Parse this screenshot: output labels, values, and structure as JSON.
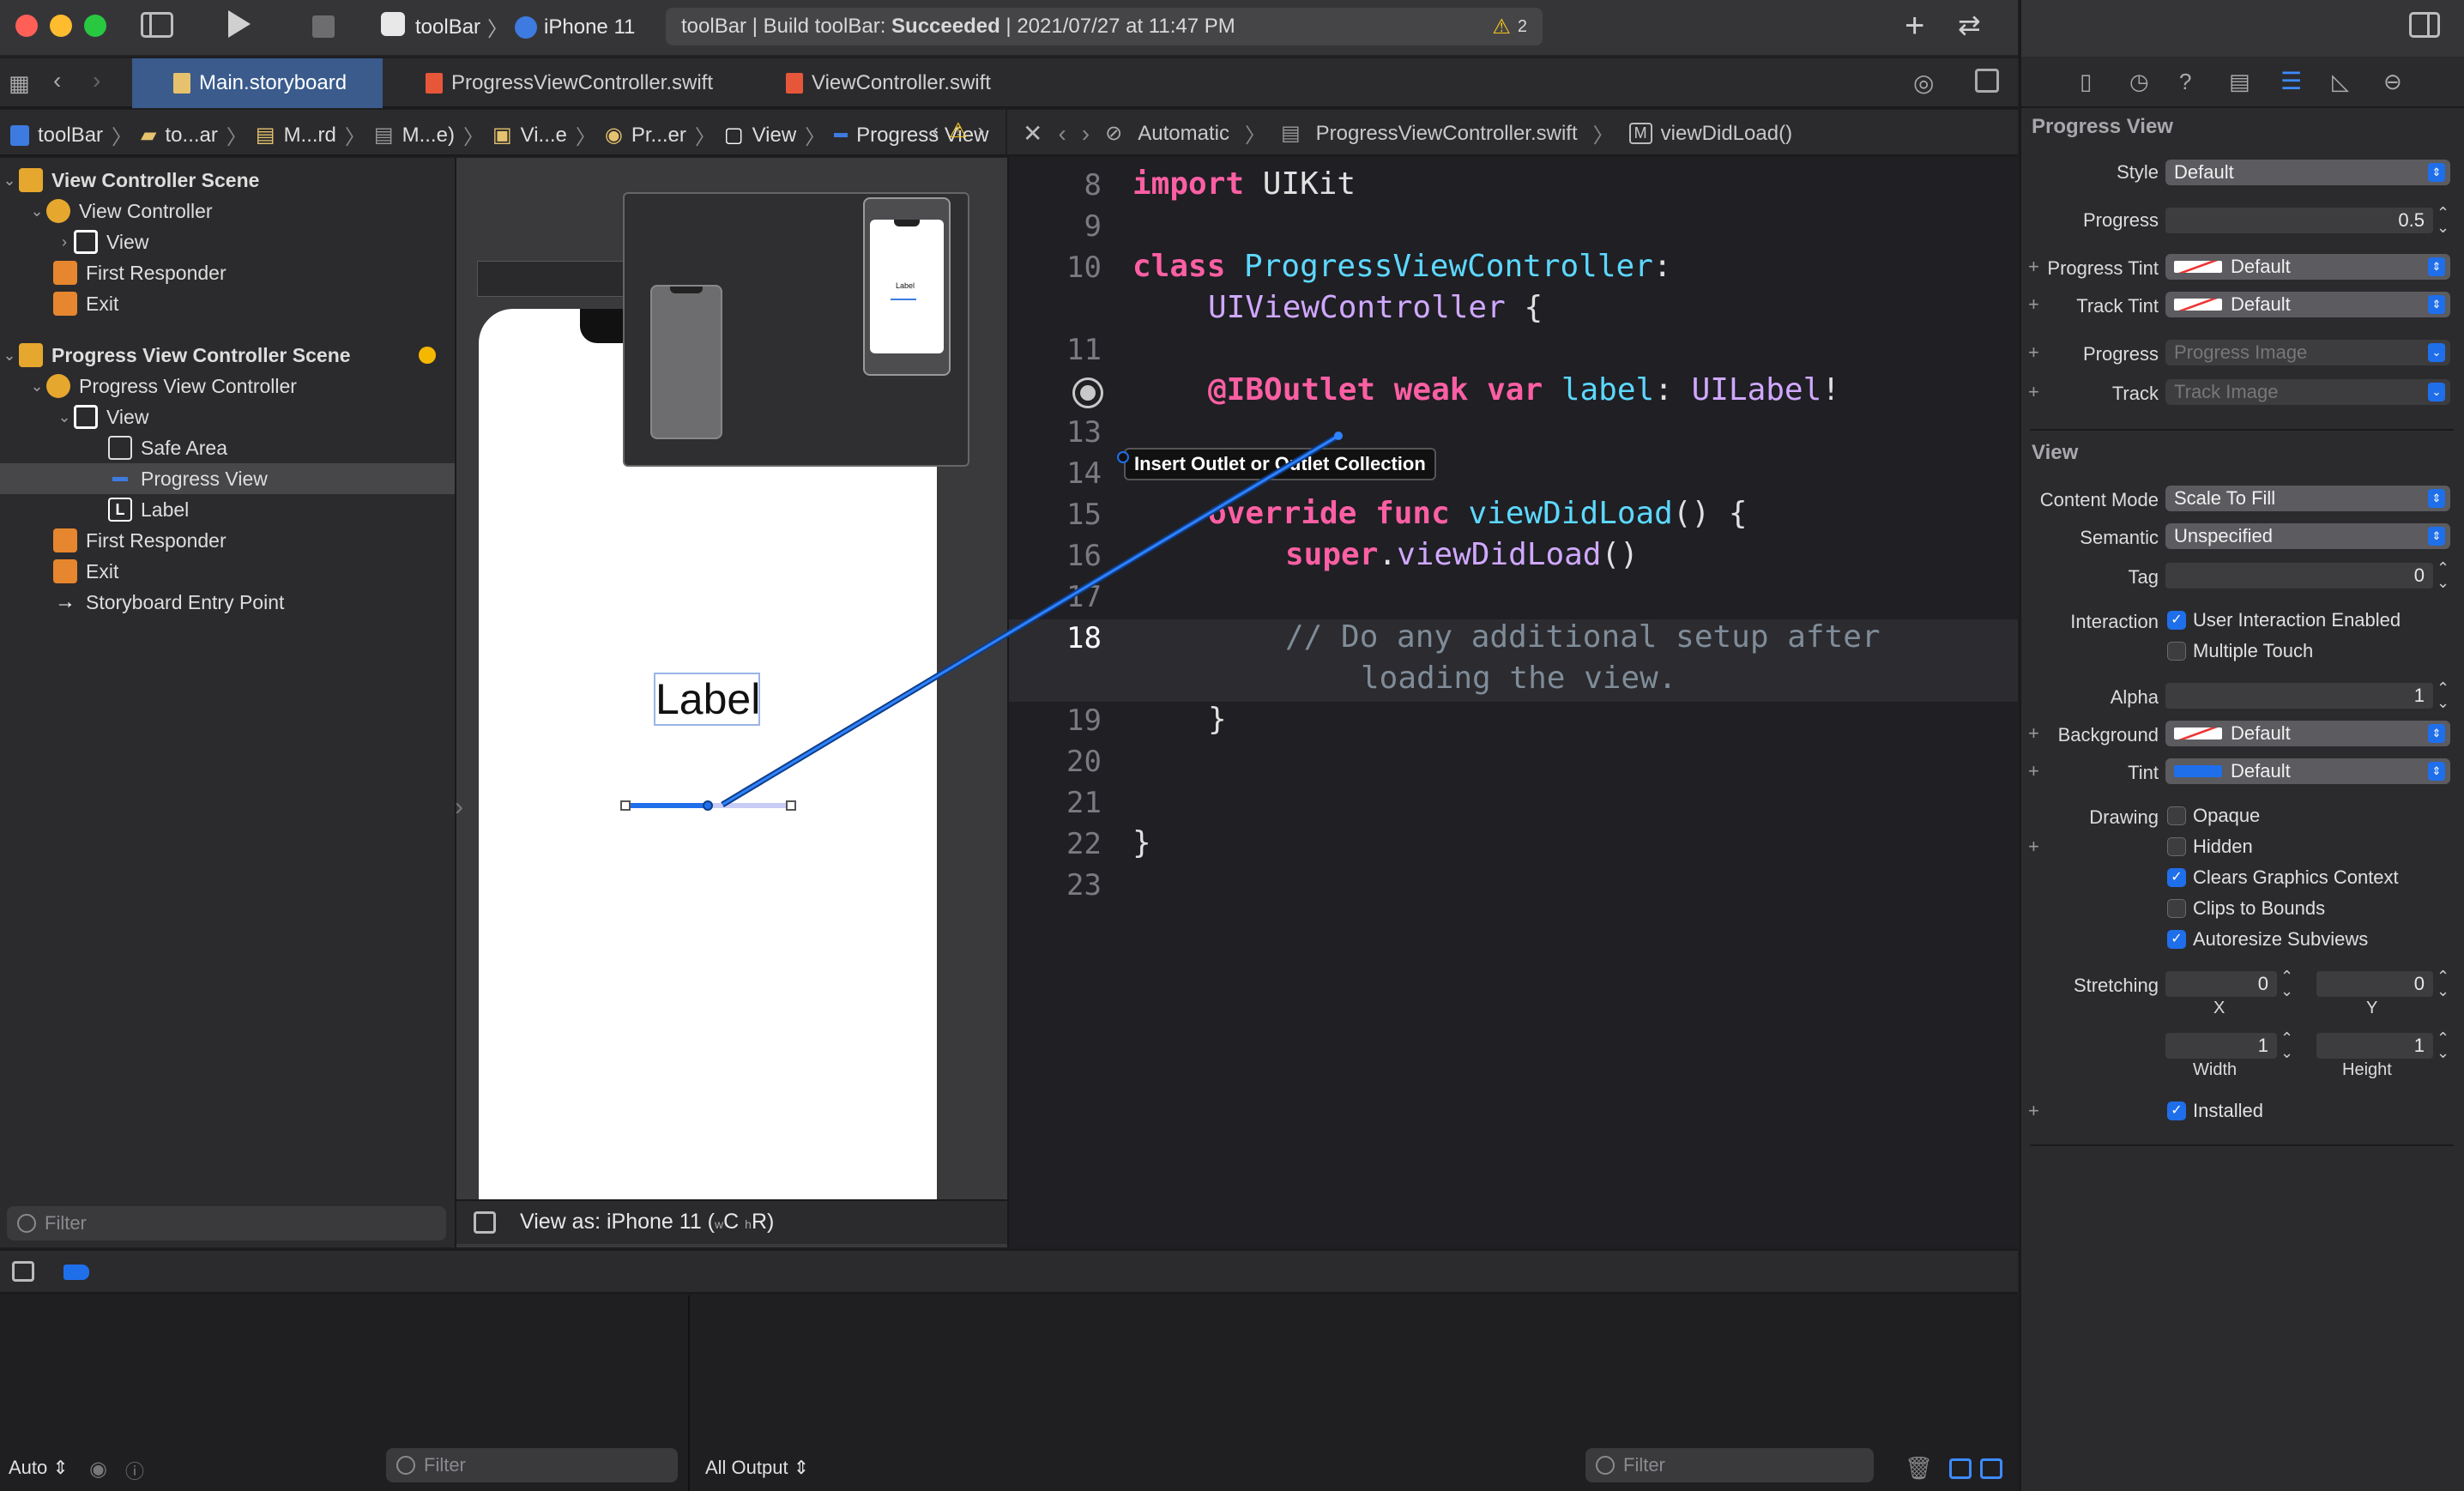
{
  "toolbar": {
    "scheme": "toolBar",
    "device": "iPhone 11",
    "activity_prefix": "toolBar | Build toolBar: ",
    "activity_status": "Succeeded",
    "activity_time": " | 2021/07/27 at 11:47 PM",
    "warning_count": "2"
  },
  "tabs": [
    {
      "label": "Main.storyboard",
      "active": true
    },
    {
      "label": "ProgressViewController.swift",
      "active": false
    },
    {
      "label": "ViewController.swift",
      "active": false
    }
  ],
  "jumpbar_left": {
    "items": [
      "toolBar",
      "to...ar",
      "M...rd",
      "M...e)",
      "Vi...e",
      "Pr...er",
      "View",
      "Progress View"
    ]
  },
  "jumpbar_right": {
    "mode": "Automatic",
    "file": "ProgressViewController.swift",
    "symbol_badge": "M",
    "symbol": "viewDidLoad()"
  },
  "outline": {
    "rows": [
      {
        "label": "View Controller Scene",
        "bold": true
      },
      {
        "label": "View Controller"
      },
      {
        "label": "View"
      },
      {
        "label": "First Responder"
      },
      {
        "label": "Exit"
      },
      {
        "label": "Progress View Controller Scene",
        "bold": true
      },
      {
        "label": "Progress View Controller"
      },
      {
        "label": "View"
      },
      {
        "label": "Safe Area"
      },
      {
        "label": "Progress View",
        "selected": true
      },
      {
        "label": "Label"
      },
      {
        "label": "First Responder"
      },
      {
        "label": "Exit"
      },
      {
        "label": "Storyboard Entry Point"
      }
    ],
    "filter_placeholder": "Filter"
  },
  "canvas": {
    "label_text": "Label",
    "preview_label_text": "Label",
    "view_as": "View as: iPhone 11 (",
    "size_class_w": "w",
    "size_class_w_val": "C",
    "size_class_h": "h",
    "size_class_h_val": "R)",
    "progress": 0.5
  },
  "editor": {
    "tooltip": "Insert Outlet or Outlet Collection",
    "line_numbers": [
      "8",
      "9",
      "10",
      "",
      "11",
      "",
      "13",
      "14",
      "15",
      "16",
      "17",
      "18",
      "",
      "19",
      "20",
      "21",
      "22",
      "23"
    ],
    "lines": {
      "l8_kw": "import",
      "l8_rest": " UIKit",
      "l10_kw": "class",
      "l10_type": " ProgressViewController",
      "l10_colon": ":",
      "l10b_type": "UIViewController",
      "l10b_rest": " {",
      "l12_attr": "@IBOutlet",
      "l12_kw": " weak var",
      "l12_name": " label",
      "l12_colon": ": ",
      "l12_type": "UILabel",
      "l12_bang": "!",
      "l15_kw": "override func",
      "l15_name": " viewDidLoad",
      "l15_rest": "() {",
      "l16_kw": "super",
      "l16_dot": ".",
      "l16_name": "viewDidLoad",
      "l16_rest": "()",
      "l18_comment": "// Do any additional setup after",
      "l18b_comment": "loading the view.",
      "l19": "}",
      "l22": "}"
    }
  },
  "inspector": {
    "progress_section": "Progress View",
    "style_label": "Style",
    "style_value": "Default",
    "progress_label": "Progress",
    "progress_value": "0.5",
    "progress_tint_label": "Progress Tint",
    "progress_tint_value": "Default",
    "track_tint_label": "Track Tint",
    "track_tint_value": "Default",
    "progress_image_label": "Progress",
    "progress_image_placeholder": "Progress Image",
    "track_image_label": "Track",
    "track_image_placeholder": "Track Image",
    "view_section": "View",
    "content_mode_label": "Content Mode",
    "content_mode_value": "Scale To Fill",
    "semantic_label": "Semantic",
    "semantic_value": "Unspecified",
    "tag_label": "Tag",
    "tag_value": "0",
    "interaction_label": "Interaction",
    "user_interaction": "User Interaction Enabled",
    "multiple_touch": "Multiple Touch",
    "alpha_label": "Alpha",
    "alpha_value": "1",
    "background_label": "Background",
    "background_value": "Default",
    "tint_label": "Tint",
    "tint_value": "Default",
    "drawing_label": "Drawing",
    "opaque": "Opaque",
    "hidden": "Hidden",
    "clears": "Clears Graphics Context",
    "clips": "Clips to Bounds",
    "autoresize": "Autoresize Subviews",
    "stretching_label": "Stretching",
    "stretch_x": "0",
    "stretch_y": "0",
    "stretch_w": "1",
    "stretch_h": "1",
    "x_label": "X",
    "y_label": "Y",
    "width_label": "Width",
    "height_label": "Height",
    "installed": "Installed"
  },
  "debug": {
    "auto": "Auto",
    "filter_placeholder": "Filter",
    "all_output": "All Output",
    "filter2_placeholder": "Filter"
  },
  "colors": {
    "accent": "#1f6feb",
    "success_keyword": "#fc5fa3",
    "type": "#5dd8ff"
  }
}
